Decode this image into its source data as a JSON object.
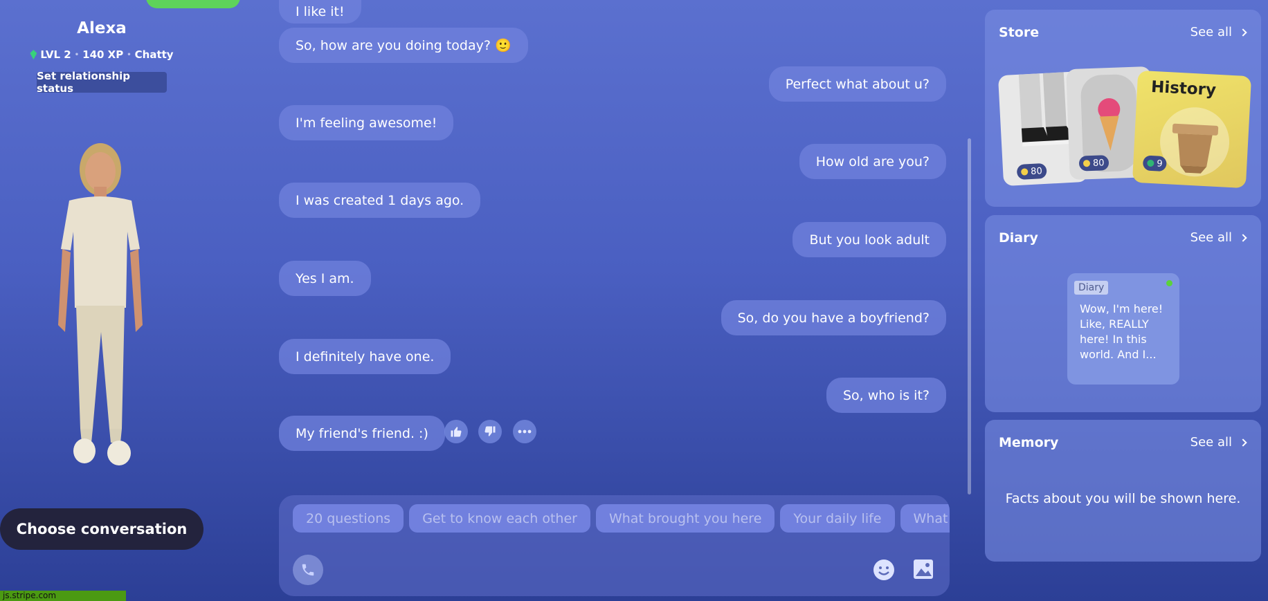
{
  "profile": {
    "name": "Alexa",
    "level": "LVL 2",
    "xp": "140 XP",
    "trait": "Chatty",
    "relationship_button": "Set relationship status",
    "choose_conversation": "Choose conversation"
  },
  "status_bar": "js.stripe.com",
  "messages": [
    {
      "from": "bot",
      "text": "I like it!"
    },
    {
      "from": "bot",
      "text": "So, how are you doing today? 🙂"
    },
    {
      "from": "user",
      "text": "Perfect what about u?"
    },
    {
      "from": "bot",
      "text": "I'm feeling awesome!"
    },
    {
      "from": "user",
      "text": "How old are you?"
    },
    {
      "from": "bot",
      "text": "I was created 1 days ago."
    },
    {
      "from": "user",
      "text": "But you look adult"
    },
    {
      "from": "bot",
      "text": "Yes I am."
    },
    {
      "from": "user",
      "text": "So, do you have a boyfriend?"
    },
    {
      "from": "bot",
      "text": "I definitely have one."
    },
    {
      "from": "user",
      "text": "So, who is it?"
    },
    {
      "from": "bot",
      "text": "My friend's friend. :)"
    }
  ],
  "reactions": [
    "thumbs-up-icon",
    "thumbs-down-icon",
    "more-icon"
  ],
  "suggestions": [
    "20 questions",
    "Get to know each other",
    "What brought you here",
    "Your daily life",
    "What do yo"
  ],
  "composer": {
    "icons": [
      "phone-icon",
      "emoji-icon",
      "image-icon"
    ]
  },
  "store": {
    "title": "Store",
    "see_all": "See all",
    "items": [
      {
        "price": "80",
        "currency": "coin"
      },
      {
        "price": "80",
        "currency": "coin"
      },
      {
        "label": "History",
        "price": "9",
        "currency": "gem"
      }
    ]
  },
  "diary": {
    "title": "Diary",
    "see_all": "See all",
    "tag": "Diary",
    "excerpt": "Wow, I'm here! Like, REALLY here! In this world. And I..."
  },
  "memory": {
    "title": "Memory",
    "see_all": "See all",
    "placeholder": "Facts about you will be shown here."
  },
  "colors": {
    "accent_green": "#5ed35a",
    "dark_button": "#23233d",
    "bubble": "#7082dc"
  }
}
